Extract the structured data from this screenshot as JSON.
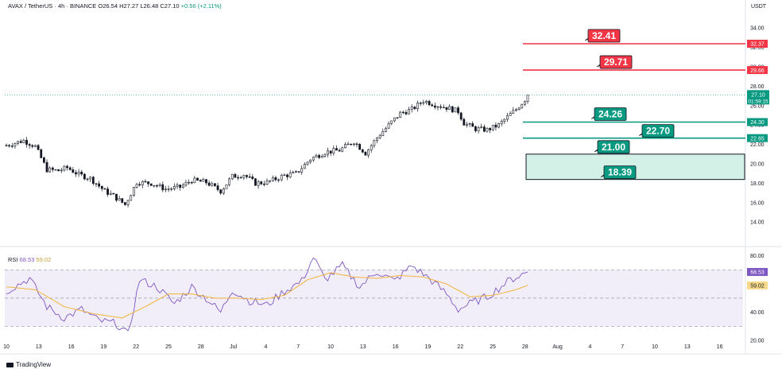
{
  "header": {
    "symbol": "AVAX / TetherUS · 4h · BINANCE",
    "ohlc": "O26.54 H27.27 L26.48 C27.10",
    "change": "+0.56 (+2.11%)"
  },
  "currency": "USDT",
  "rsi_label": {
    "name": "RSI",
    "value1": "68.53",
    "value2": "59.02"
  },
  "brand": "TradingView",
  "colors": {
    "up": "#089981",
    "down": "#f23645",
    "rsi": "#7e57c2",
    "rsi_ma": "#f0b43a",
    "rsi_band": "#ede7f6"
  },
  "chart_data": [
    {
      "type": "candlestick",
      "x_tick_labels": [
        "10",
        "13",
        "16",
        "19",
        "22",
        "25",
        "28",
        "Jul",
        "4",
        "7",
        "10",
        "13",
        "16",
        "19",
        "22",
        "25",
        "28",
        "Aug",
        "4",
        "7",
        "10",
        "13",
        "16"
      ],
      "y_ticks": [
        14,
        16,
        18,
        20,
        22,
        24,
        26,
        28,
        30,
        32,
        34
      ],
      "y_tick_labels": [
        "14.00",
        "16.00",
        "18.00",
        "20.00",
        "22.00",
        "24.00",
        "26.00",
        "28.00",
        "30.00",
        "32.00",
        "34.00"
      ],
      "ylim": [
        12.3,
        35.4
      ],
      "price_path": [
        [
          0,
          21.9
        ],
        [
          6,
          22.4
        ],
        [
          10,
          21.8
        ],
        [
          14,
          19.4
        ],
        [
          18,
          19.3
        ],
        [
          21,
          19.6
        ],
        [
          25,
          18.9
        ],
        [
          29,
          18.5
        ],
        [
          34,
          17.2
        ],
        [
          37,
          16.7
        ],
        [
          41,
          15.8
        ],
        [
          45,
          18.1
        ],
        [
          50,
          18.0
        ],
        [
          55,
          17.4
        ],
        [
          60,
          17.6
        ],
        [
          64,
          18.3
        ],
        [
          69,
          18.1
        ],
        [
          74,
          17.2
        ],
        [
          78,
          18.7
        ],
        [
          82,
          18.9
        ],
        [
          86,
          18.0
        ],
        [
          90,
          18.1
        ],
        [
          96,
          18.8
        ],
        [
          100,
          19.0
        ],
        [
          105,
          20.5
        ],
        [
          110,
          21.2
        ],
        [
          115,
          21.4
        ],
        [
          120,
          22.3
        ],
        [
          124,
          21.1
        ],
        [
          128,
          22.7
        ],
        [
          132,
          24.0
        ],
        [
          136,
          25.2
        ],
        [
          140,
          25.6
        ],
        [
          144,
          26.5
        ],
        [
          148,
          26.1
        ],
        [
          152,
          25.8
        ],
        [
          156,
          25.4
        ],
        [
          158,
          24.2
        ],
        [
          162,
          23.6
        ],
        [
          166,
          23.5
        ],
        [
          170,
          24.0
        ],
        [
          174,
          25.1
        ],
        [
          176,
          25.6
        ],
        [
          179,
          26.6
        ],
        [
          180,
          27.1
        ]
      ],
      "levels": [
        {
          "price": 32.37,
          "label": "32.41",
          "axis_label": "32.37",
          "kind": "resistance"
        },
        {
          "price": 29.66,
          "label": "29.71",
          "axis_label": "29.66",
          "kind": "resistance"
        },
        {
          "price": 24.3,
          "label": "24.26",
          "axis_label": "24.30",
          "kind": "support"
        },
        {
          "price": 22.65,
          "label": "22.70",
          "axis_label": "22.65",
          "kind": "support"
        }
      ],
      "zone": {
        "top": 21.0,
        "bottom": 18.39,
        "label_top": "21.00",
        "label_bottom": "18.39"
      },
      "last_price": {
        "value": 27.1,
        "label": "27.10",
        "countdown": "01:59:15"
      }
    },
    {
      "type": "line",
      "title": "RSI",
      "y_ticks": [
        20,
        40,
        60,
        80
      ],
      "y_tick_labels": [
        "20.00",
        "40.00",
        "60.00",
        "80.00"
      ],
      "ylim": [
        19,
        82
      ],
      "band": [
        30,
        70
      ],
      "series": [
        {
          "name": "RSI",
          "color": "#7e57c2",
          "path": [
            [
              0,
              55
            ],
            [
              8,
              64
            ],
            [
              14,
              44
            ],
            [
              20,
              36
            ],
            [
              26,
              42
            ],
            [
              32,
              34
            ],
            [
              38,
              32
            ],
            [
              42,
              24
            ],
            [
              46,
              63
            ],
            [
              52,
              58
            ],
            [
              58,
              46
            ],
            [
              64,
              58
            ],
            [
              70,
              48
            ],
            [
              74,
              40
            ],
            [
              78,
              56
            ],
            [
              84,
              48
            ],
            [
              90,
              45
            ],
            [
              96,
              55
            ],
            [
              102,
              62
            ],
            [
              106,
              79
            ],
            [
              110,
              63
            ],
            [
              116,
              73
            ],
            [
              122,
              58
            ],
            [
              128,
              69
            ],
            [
              134,
              62
            ],
            [
              140,
              73
            ],
            [
              146,
              64
            ],
            [
              152,
              53
            ],
            [
              156,
              42
            ],
            [
              160,
              46
            ],
            [
              166,
              51
            ],
            [
              170,
              57
            ],
            [
              174,
              63
            ],
            [
              180,
              68.53
            ]
          ]
        },
        {
          "name": "RSI-based MA",
          "color": "#f0b43a",
          "path": [
            [
              0,
              58
            ],
            [
              10,
              56
            ],
            [
              20,
              44
            ],
            [
              30,
              39
            ],
            [
              40,
              36
            ],
            [
              48,
              44
            ],
            [
              56,
              53
            ],
            [
              64,
              53
            ],
            [
              72,
              50
            ],
            [
              80,
              50
            ],
            [
              88,
              49
            ],
            [
              96,
              52
            ],
            [
              104,
              63
            ],
            [
              112,
              68
            ],
            [
              120,
              65
            ],
            [
              128,
              64
            ],
            [
              136,
              66
            ],
            [
              144,
              65
            ],
            [
              152,
              60
            ],
            [
              160,
              51
            ],
            [
              168,
              52
            ],
            [
              176,
              56
            ],
            [
              180,
              59.02
            ]
          ]
        }
      ],
      "last_values": [
        "68.53",
        "59.02"
      ]
    }
  ]
}
